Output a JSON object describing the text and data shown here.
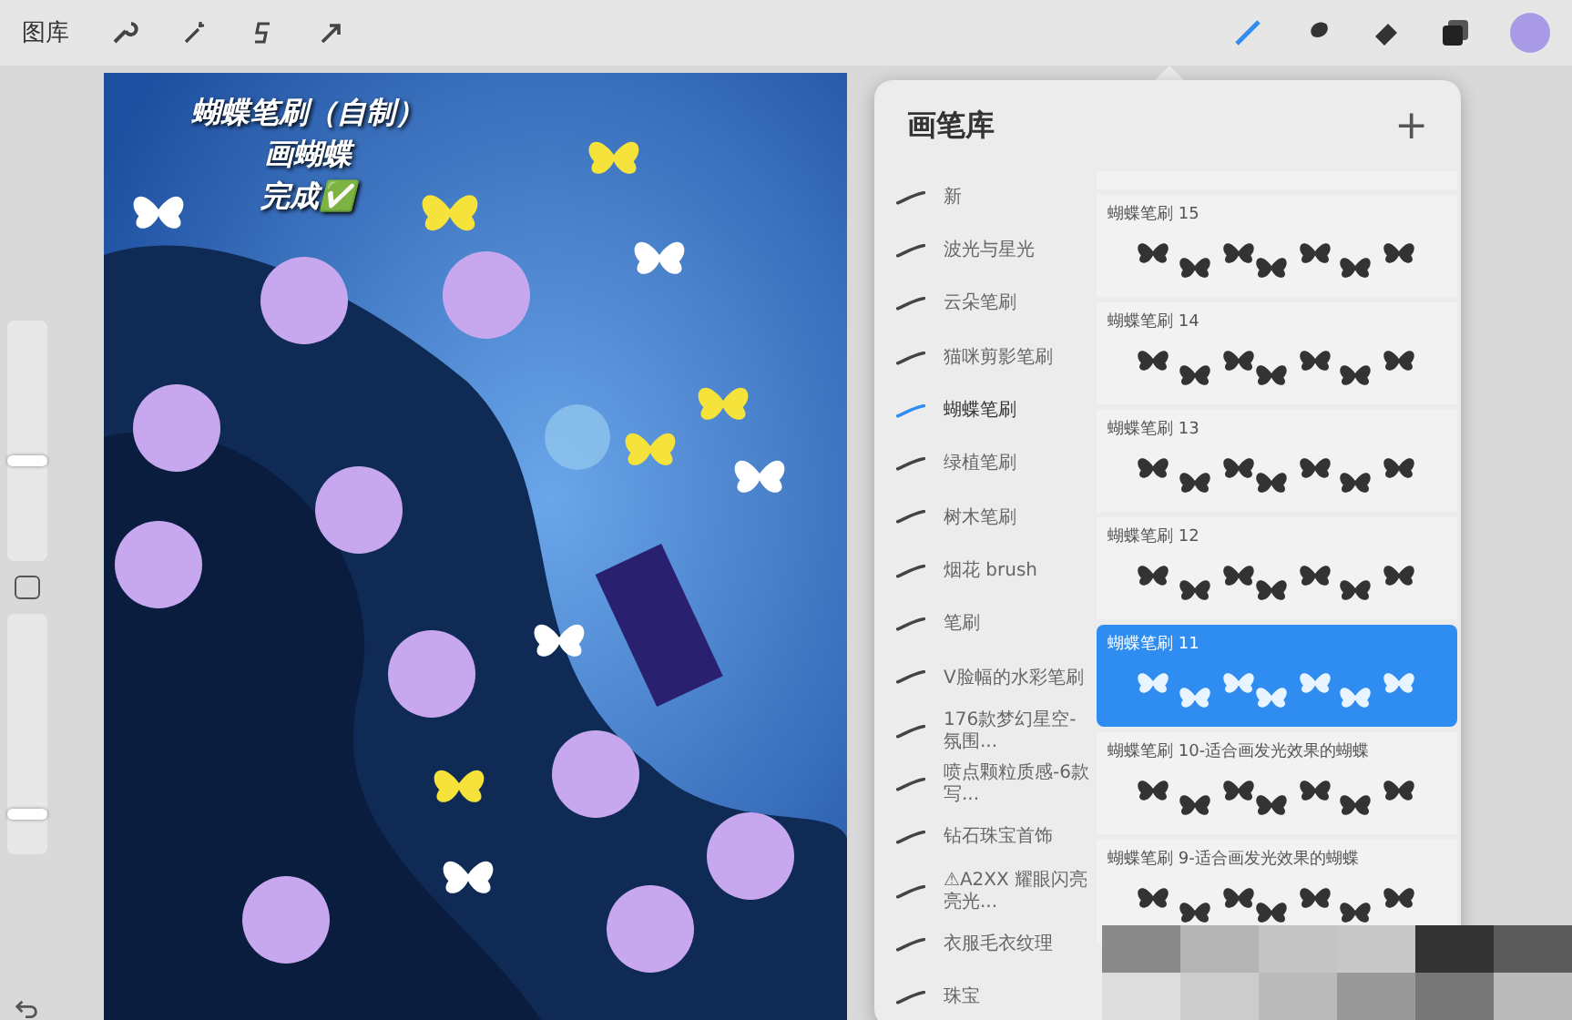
{
  "toolbar": {
    "gallery": "图库"
  },
  "sidebar": {
    "brush_size": {
      "level": 0.45
    },
    "opacity": {
      "level": 0.2
    }
  },
  "canvas": {
    "caption": [
      "蝴蝶笔刷（自制）",
      "画蝴蝶",
      "完成✅"
    ]
  },
  "brush_library": {
    "title": "画笔库",
    "add": "+",
    "sets": [
      {
        "name": "新",
        "selected": false
      },
      {
        "name": "波光与星光",
        "selected": false
      },
      {
        "name": "云朵笔刷",
        "selected": false
      },
      {
        "name": "猫咪剪影笔刷",
        "selected": false
      },
      {
        "name": "蝴蝶笔刷",
        "selected": true
      },
      {
        "name": "绿植笔刷",
        "selected": false
      },
      {
        "name": "树木笔刷",
        "selected": false
      },
      {
        "name": "烟花 brush",
        "selected": false
      },
      {
        "name": "笔刷",
        "selected": false
      },
      {
        "name": "V脸幅的水彩笔刷",
        "selected": false
      },
      {
        "name": "176款梦幻星空-氛围...",
        "selected": false
      },
      {
        "name": "喷点颗粒质感-6款写...",
        "selected": false
      },
      {
        "name": "钻石珠宝首饰",
        "selected": false
      },
      {
        "name": "⚠A2XX 耀眼闪亮亮光...",
        "selected": false
      },
      {
        "name": "衣服毛衣纹理",
        "selected": false
      },
      {
        "name": "珠宝",
        "selected": false
      }
    ],
    "brushes": [
      {
        "name": "蝴蝶笔刷 15",
        "selected": false
      },
      {
        "name": "蝴蝶笔刷 14",
        "selected": false
      },
      {
        "name": "蝴蝶笔刷 13",
        "selected": false
      },
      {
        "name": "蝴蝶笔刷 12",
        "selected": false
      },
      {
        "name": "蝴蝶笔刷 11",
        "selected": true
      },
      {
        "name": "蝴蝶笔刷 10-适合画发光效果的蝴蝶",
        "selected": false
      },
      {
        "name": "蝴蝶笔刷 9-适合画发光效果的蝴蝶",
        "selected": false
      }
    ]
  }
}
